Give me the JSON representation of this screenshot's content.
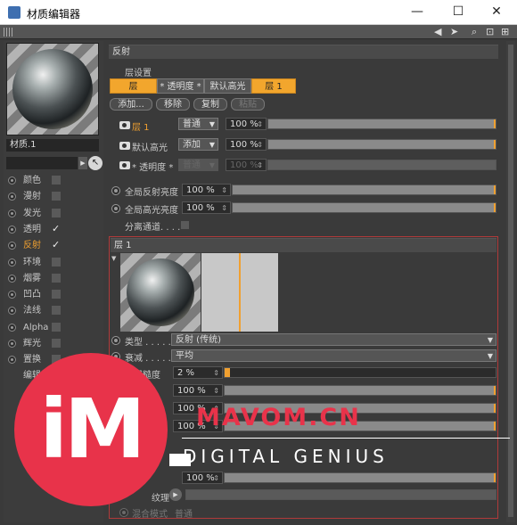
{
  "window": {
    "title": "材质编辑器",
    "minimize": "—",
    "maximize": "☐",
    "close": "✕"
  },
  "material": {
    "name": "材质.1"
  },
  "channels": [
    {
      "label": "颜色",
      "checked": false,
      "active": false
    },
    {
      "label": "漫射",
      "checked": false,
      "active": false
    },
    {
      "label": "发光",
      "checked": false,
      "active": false
    },
    {
      "label": "透明",
      "checked": true,
      "active": false
    },
    {
      "label": "反射",
      "checked": true,
      "active": true
    },
    {
      "label": "环境",
      "checked": false,
      "active": false
    },
    {
      "label": "烟雾",
      "checked": false,
      "active": false
    },
    {
      "label": "凹凸",
      "checked": false,
      "active": false
    },
    {
      "label": "法线",
      "checked": false,
      "active": false
    },
    {
      "label": "Alpha",
      "checked": false,
      "active": false
    },
    {
      "label": "辉光",
      "checked": false,
      "active": false
    },
    {
      "label": "置换",
      "checked": false,
      "active": false
    }
  ],
  "channel_sub": "编辑",
  "reflection": {
    "header": "反射",
    "layer_settings_label": "层设置",
    "tabs": [
      "层",
      "* 透明度 *",
      "默认高光",
      "层 1"
    ],
    "buttons": {
      "add": "添加...",
      "remove": "移除",
      "copy": "复制",
      "paste": "粘贴"
    },
    "layers": [
      {
        "name": "层 1",
        "mode": "普通",
        "value": "100 %",
        "highlight": true,
        "disabled": false
      },
      {
        "name": "默认高光",
        "mode": "添加",
        "value": "100 %",
        "highlight": false,
        "disabled": false
      },
      {
        "name": "* 透明度 *",
        "mode": "普通",
        "value": "100 %",
        "highlight": false,
        "disabled": true
      }
    ],
    "global_reflection_label": "全局反射亮度",
    "global_reflection_value": "100 %",
    "global_highlight_label": "全局高光亮度",
    "global_highlight_value": "100 %",
    "separate_channels_label": "分离通道. . . ."
  },
  "layer1": {
    "header": "层 1",
    "type_label": "类型 . . . . .",
    "type_value": "反射 (传统)",
    "attenuation_label": "衰减 . . . . .",
    "attenuation_value": "平均",
    "roughness_label": "粗糙度",
    "roughness_value": "2 %",
    "roughness_fraction": 0.02,
    "rows_values": [
      "100 %",
      "100 %",
      "100 %"
    ],
    "bottom_value": "100 %",
    "texture_label": "纹理",
    "blend_mode_label": "混合模式",
    "blend_mode_value": "普通"
  },
  "watermark": {
    "logo": "iM",
    "site": "MAVOM.CN",
    "tagline": "DIGITAL GENIUS"
  },
  "colors": {
    "accent": "#f0a030",
    "watermark": "#e8334a",
    "panel": "#3a3a3a"
  }
}
